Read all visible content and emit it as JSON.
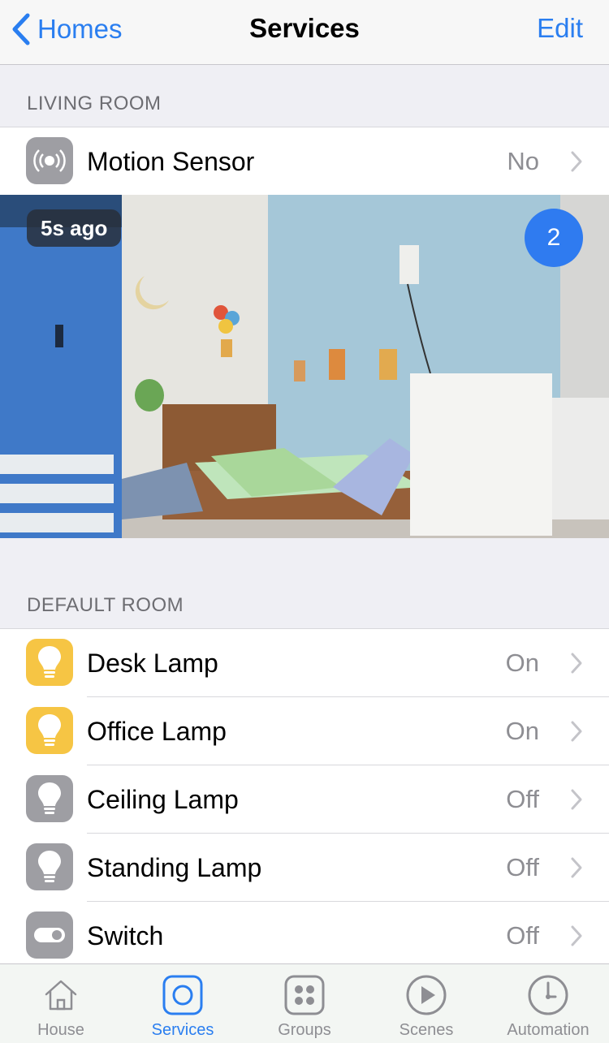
{
  "nav": {
    "back_label": "Homes",
    "title": "Services",
    "edit_label": "Edit"
  },
  "sections": [
    {
      "title": "LIVING ROOM"
    },
    {
      "title": "DEFAULT ROOM"
    }
  ],
  "living_room": {
    "motion_sensor": {
      "name": "Motion Sensor",
      "value": "No",
      "icon": "motion-sensor-icon"
    },
    "camera": {
      "time_badge": "5s ago",
      "count_badge": "2"
    }
  },
  "default_room": {
    "items": [
      {
        "name": "Desk Lamp",
        "value": "On",
        "icon": "lightbulb-icon",
        "color": "#f6c544"
      },
      {
        "name": "Office Lamp",
        "value": "On",
        "icon": "lightbulb-icon",
        "color": "#f6c544"
      },
      {
        "name": "Ceiling Lamp",
        "value": "Off",
        "icon": "lightbulb-icon",
        "color": "#9e9ea3"
      },
      {
        "name": "Standing Lamp",
        "value": "Off",
        "icon": "lightbulb-icon",
        "color": "#9e9ea3"
      },
      {
        "name": "Switch",
        "value": "Off",
        "icon": "switch-icon",
        "color": "#9e9ea3"
      }
    ]
  },
  "tabbar": {
    "tabs": [
      {
        "label": "House",
        "icon": "house-icon"
      },
      {
        "label": "Services",
        "icon": "services-icon",
        "active": true
      },
      {
        "label": "Groups",
        "icon": "groups-icon"
      },
      {
        "label": "Scenes",
        "icon": "scenes-icon"
      },
      {
        "label": "Automation",
        "icon": "automation-icon"
      }
    ]
  },
  "colors": {
    "accent": "#2a7ef0",
    "on_tile": "#f6c544",
    "off_tile": "#9e9ea3",
    "badge_blue": "#2f7bf0"
  }
}
